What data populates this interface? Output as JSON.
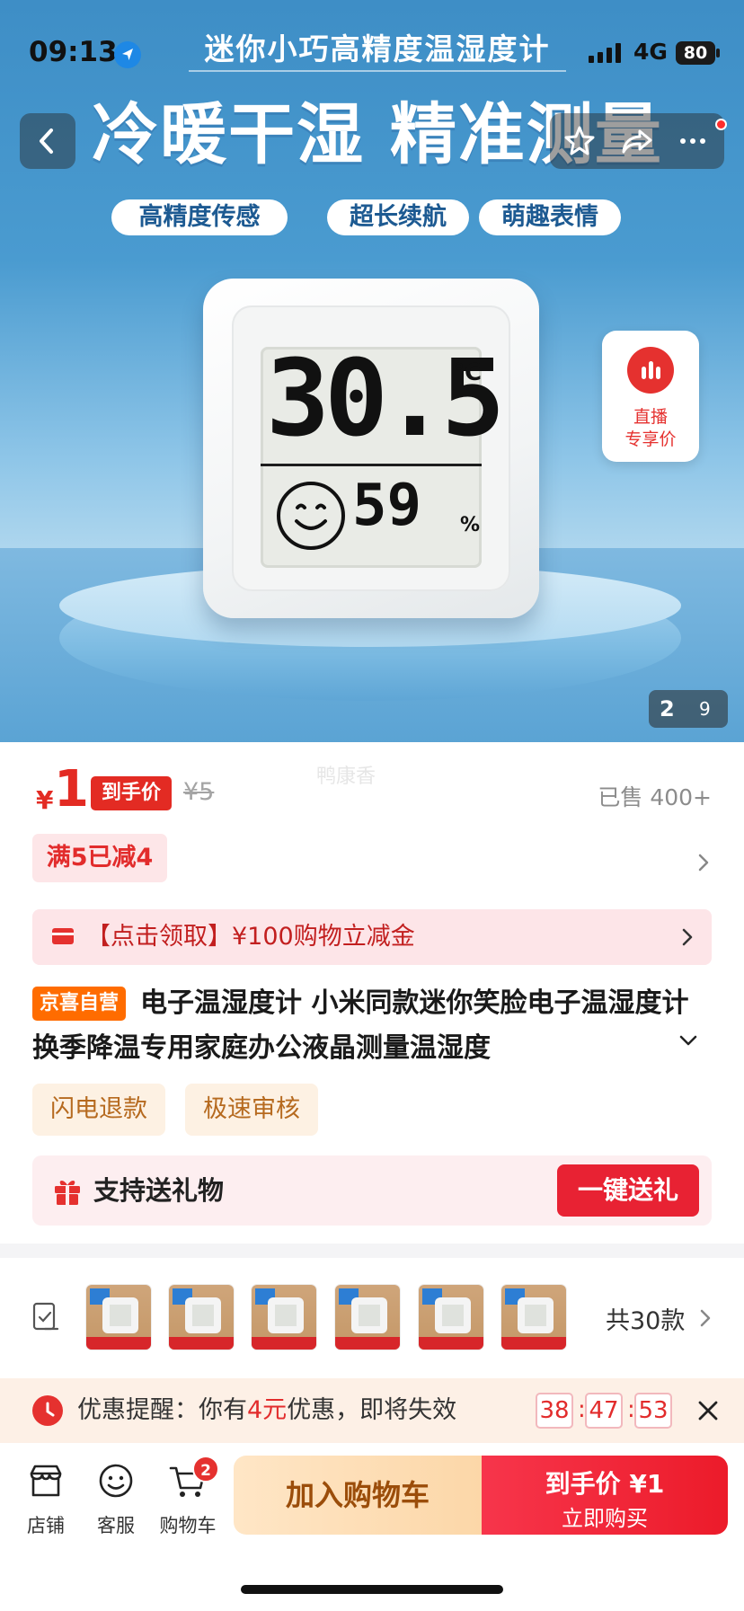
{
  "status_bar": {
    "time": "09:13",
    "network": "4G",
    "battery": "80"
  },
  "hero": {
    "subheadline": "迷你小巧高精度温湿度计",
    "headline": "冷暖干湿 精准测量",
    "feature_tags": [
      "高精度传感",
      "超长续航",
      "萌趣表情"
    ],
    "display": {
      "temperature": "30.5",
      "temp_unit": "°C",
      "humidity": "59",
      "humidity_unit": "%"
    },
    "live_badge": {
      "line1": "直播",
      "line2": "专享价"
    },
    "pager": {
      "current": "2",
      "total": "9"
    }
  },
  "watermark": "鸭康香",
  "price": {
    "symbol": "¥",
    "value": "1",
    "badge": "到手价",
    "original": "¥5",
    "sold": "已售 400+"
  },
  "promo": {
    "tag": "满5已减4"
  },
  "coupon": {
    "text": "【点击领取】¥100购物立减金"
  },
  "product": {
    "store_tag": "京喜自营",
    "title": "电子温湿度计 小米同款迷你笑脸电子温湿度计 换季降温专用家庭办公液晶测量温湿度"
  },
  "service_tags": [
    "闪电退款",
    "极速审核"
  ],
  "gift": {
    "text": "支持送礼物",
    "button": "一键送礼"
  },
  "variants": {
    "count_label": "共30款",
    "thumb_count": 6
  },
  "reminder": {
    "prefix": "优惠提醒：你有",
    "amount": "4元",
    "suffix": "优惠，即将失效",
    "countdown": {
      "h": "38",
      "m": "47",
      "s": "53"
    }
  },
  "bottom_bar": {
    "store": "店铺",
    "service": "客服",
    "cart": "购物车",
    "cart_count": "2",
    "add_to_cart": "加入购物车",
    "buy_price": "到手价 ¥1",
    "buy_label": "立即购买"
  },
  "colors": {
    "accent_red": "#e32b23",
    "orange_tag": "#ff6c00",
    "hero_blue": "#4a9bd0"
  }
}
